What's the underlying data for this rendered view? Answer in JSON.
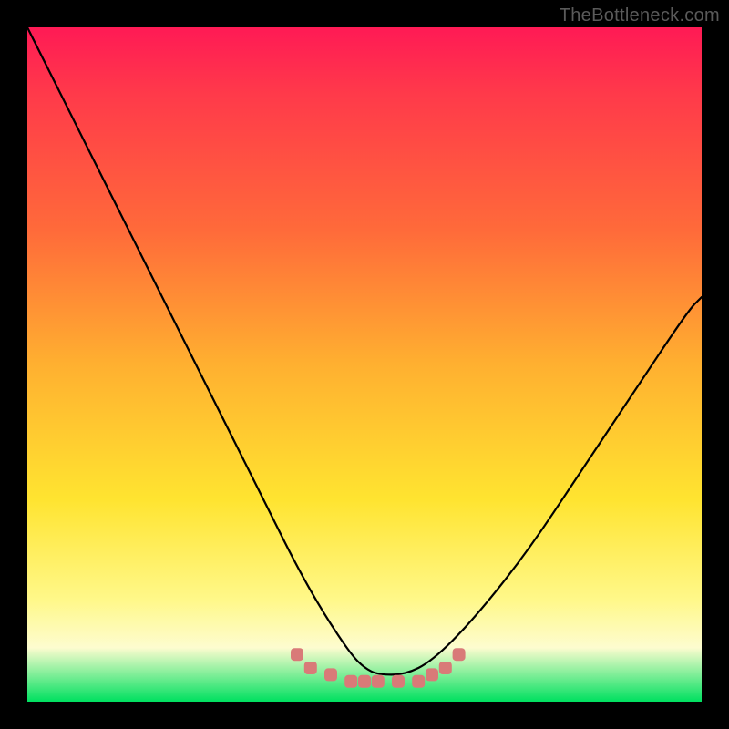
{
  "watermark": "TheBottleneck.com",
  "chart_data": {
    "type": "line",
    "title": "",
    "xlabel": "",
    "ylabel": "",
    "xlim": [
      0,
      100
    ],
    "ylim": [
      0,
      100
    ],
    "grid": false,
    "series": [
      {
        "name": "curve",
        "color": "#000000",
        "x": [
          0,
          6,
          12,
          18,
          24,
          30,
          36,
          40,
          44,
          48,
          50,
          52,
          56,
          60,
          66,
          74,
          82,
          90,
          98,
          100
        ],
        "values": [
          100,
          88,
          76,
          64,
          52,
          40,
          28,
          20,
          13,
          7,
          5,
          4,
          4,
          6,
          12,
          22,
          34,
          46,
          58,
          60
        ]
      },
      {
        "name": "bottom-markers",
        "color": "#d97a78",
        "x": [
          40,
          42,
          45,
          48,
          50,
          52,
          55,
          58,
          60,
          62,
          64
        ],
        "values": [
          7,
          5,
          4,
          3,
          3,
          3,
          3,
          3,
          4,
          5,
          7
        ]
      }
    ],
    "background_gradient": {
      "direction": "top-to-bottom",
      "stops": [
        {
          "pos": 0,
          "color": "#ff1a55"
        },
        {
          "pos": 10,
          "color": "#ff3a4a"
        },
        {
          "pos": 30,
          "color": "#ff6a3a"
        },
        {
          "pos": 50,
          "color": "#ffb030"
        },
        {
          "pos": 70,
          "color": "#ffe430"
        },
        {
          "pos": 85,
          "color": "#fff88a"
        },
        {
          "pos": 92,
          "color": "#fdfccf"
        },
        {
          "pos": 100,
          "color": "#00e060"
        }
      ]
    }
  }
}
